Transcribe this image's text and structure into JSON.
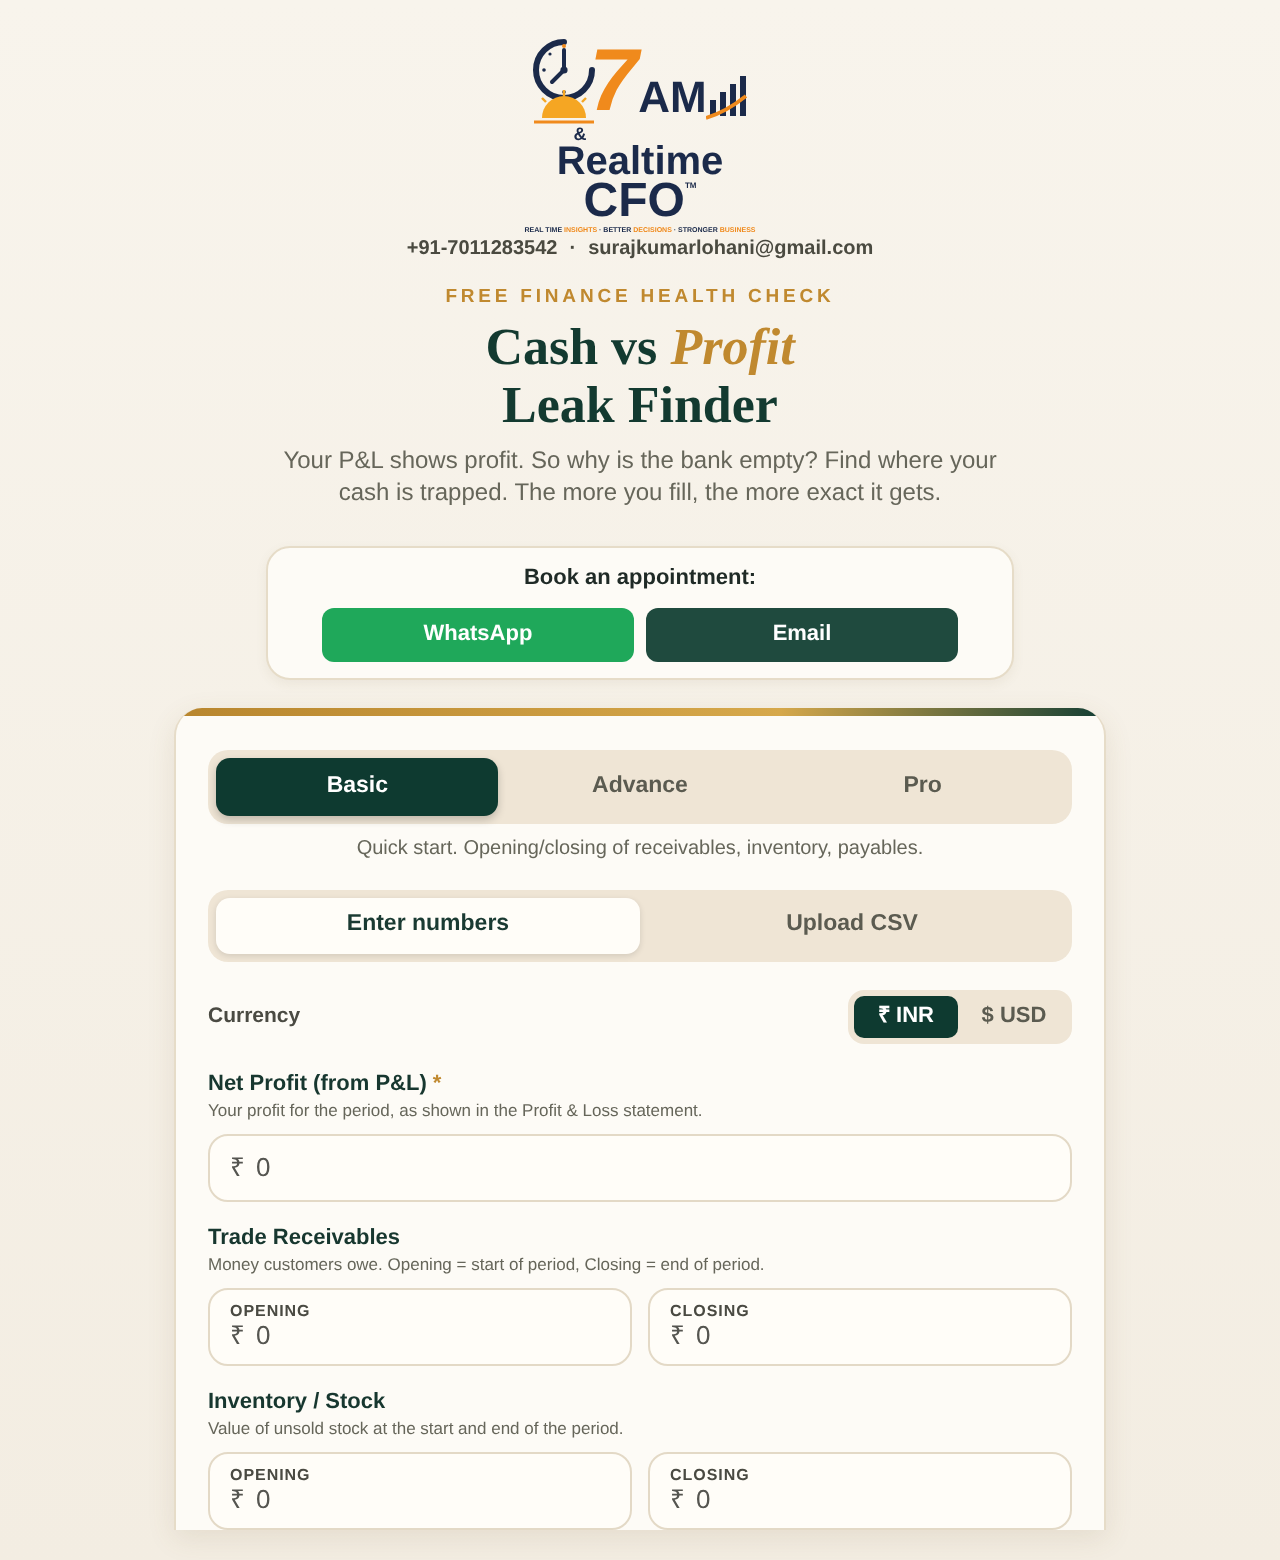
{
  "logo": {
    "numeral": "7",
    "word": "AM",
    "ampersand": "&",
    "line_1": "Realtime",
    "line_2": "CFO",
    "trademark": "TM",
    "tagline": "REAL TIME *INSIGHTS* · BETTER *DECISIONS* · STRONGER *BUSINESS*"
  },
  "contact": {
    "phone": "+91-7011283542",
    "separator": "·",
    "email": "surajkumarlohani@gmail.com"
  },
  "eyebrow": "FREE FINANCE HEALTH CHECK",
  "title": "Cash vs *Profit* Leak Finder",
  "subtitle": "Your P&L shows profit. So why is the bank empty? Find where your cash is trapped. The more you fill, the more exact it gets.",
  "appointment": {
    "label": "Book an appointment:",
    "buttons": [
      {
        "label": "WhatsApp",
        "kind": "whatsapp"
      },
      {
        "label": "Email",
        "kind": "email"
      }
    ]
  },
  "form": {
    "tiers": [
      {
        "label": "Basic",
        "selected": true
      },
      {
        "label": "Advance",
        "selected": false
      },
      {
        "label": "Pro",
        "selected": false
      }
    ],
    "tier_description": "Quick start. Opening/closing of receivables, inventory, payables.",
    "modes": [
      {
        "label": "Enter numbers",
        "selected": true
      },
      {
        "label": "Upload CSV",
        "selected": false
      }
    ],
    "currency": {
      "label": "Currency",
      "options": [
        {
          "label": "₹ INR",
          "selected": true
        },
        {
          "label": "$ USD",
          "selected": false
        }
      ]
    },
    "fields": [
      {
        "kind": "single",
        "label": "Net Profit (from P&L)",
        "required_mark": "*",
        "hint": "Your profit for the period, as shown in the Profit & Loss statement.",
        "inputs": [
          {
            "prefix": "₹",
            "value": "0"
          }
        ]
      },
      {
        "kind": "pair",
        "label": "Trade Receivables",
        "hint": "Money customers owe. Opening = start of period, Closing = end of period.",
        "inputs": [
          {
            "caption": "OPENING",
            "prefix": "₹",
            "value": "0"
          },
          {
            "caption": "CLOSING",
            "prefix": "₹",
            "value": "0"
          }
        ]
      },
      {
        "kind": "pair",
        "label": "Inventory / Stock",
        "hint": "Value of unsold stock at the start and end of the period.",
        "inputs": [
          {
            "caption": "OPENING",
            "prefix": "₹",
            "value": "0"
          },
          {
            "caption": "CLOSING",
            "prefix": "₹",
            "value": "0"
          }
        ]
      }
    ]
  }
}
